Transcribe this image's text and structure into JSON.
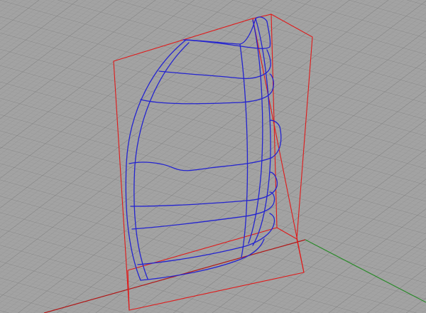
{
  "viewport": {
    "projection": "perspective",
    "background_color": "#a3a3a3",
    "grid_color": "#8e8e8e",
    "grid_major_color": "#7d7d7d",
    "x_axis_color": "#b01818",
    "y_axis_color": "#2a8a2a"
  },
  "model": {
    "curve_color": "#2424d0",
    "bounding_box_color": "#e01a1a",
    "object": "wireframe-surface-curves",
    "selected": true
  }
}
